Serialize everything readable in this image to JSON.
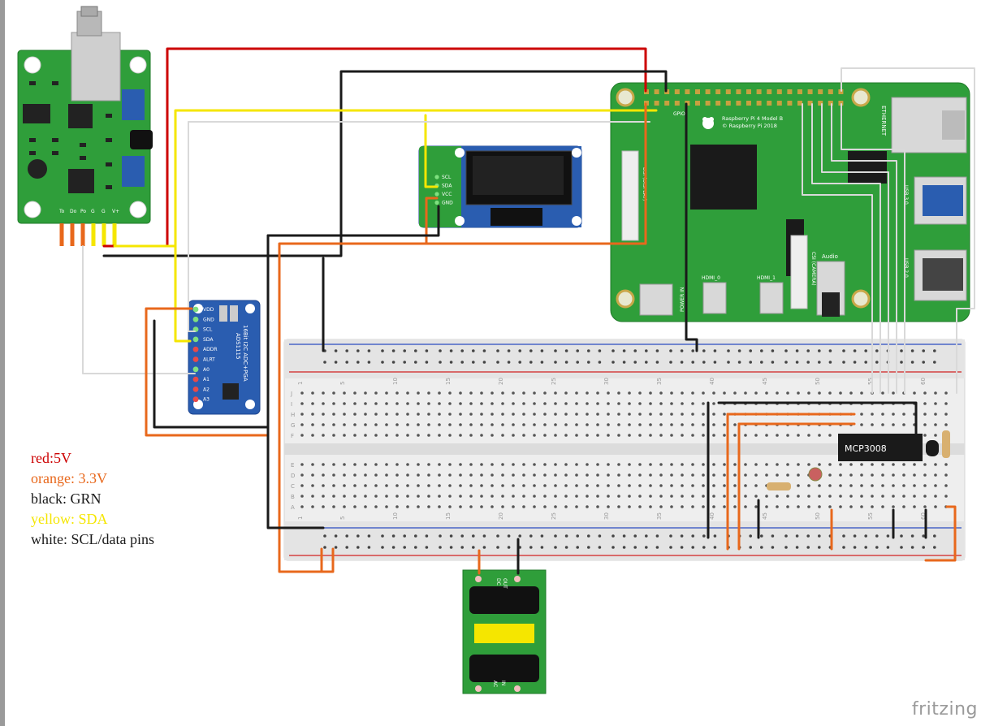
{
  "colors": {
    "wire_red": "#cc0000",
    "wire_orange": "#e8681c",
    "wire_black": "#1a1a1a",
    "wire_yellow": "#f5e600",
    "wire_white": "#d9d9d9",
    "pcb_green": "#2f9e3a",
    "pcb_blue": "#2a5db0",
    "breadboard": "#ececec"
  },
  "legend": [
    {
      "text": "red:5V",
      "color": "#cc0000"
    },
    {
      "text": "orange: 3.3V",
      "color": "#e8681c"
    },
    {
      "text": "black: GRN",
      "color": "#1a1a1a"
    },
    {
      "text": "yellow: SDA",
      "color": "#f5e600"
    },
    {
      "text": "white: SCL/data pins",
      "color": "#1a1a1a"
    }
  ],
  "watermark": "fritzing",
  "sensor_board": {
    "pin_labels": [
      "To",
      "Do",
      "Po",
      "G",
      "G",
      "V+"
    ]
  },
  "oled": {
    "pins": [
      "SCL",
      "SDA",
      "VCC",
      "GND"
    ]
  },
  "ads1115": {
    "title": "16Bit I2C ADC+PGA",
    "part": "ADS1115",
    "pins": [
      "VDD",
      "GND",
      "SCL",
      "SDA",
      "ADDR",
      "ALRT",
      "A0",
      "A1",
      "A2",
      "A3"
    ]
  },
  "raspberry_pi": {
    "model_line1": "Raspberry Pi 4 Model B",
    "model_line2": "© Raspberry Pi 2018",
    "gpio_label": "GPIO",
    "ethernet": "ETHERNET",
    "usb1": "USB 3.0",
    "usb2": "USB 2.0",
    "hdmi0": "HDMI_0",
    "hdmi1": "HDMI_1",
    "power": "POWER IN",
    "csi": "CSI (CAMERA)",
    "dsi": "DSI (DISPLAY)",
    "audio": "Audio"
  },
  "breadboard": {
    "col_numbers": [
      "1",
      "5",
      "10",
      "15",
      "20",
      "25",
      "30",
      "35",
      "40",
      "45",
      "50",
      "55",
      "60"
    ],
    "row_letters_top": [
      "J",
      "I",
      "H",
      "G",
      "F"
    ],
    "row_letters_bottom": [
      "E",
      "D",
      "C",
      "B",
      "A"
    ]
  },
  "chip": {
    "label": "MCP3008"
  },
  "psu": {
    "top_label1": "DC",
    "top_label2": "OUT",
    "bottom_label1": "AC",
    "bottom_label2": "IN"
  }
}
